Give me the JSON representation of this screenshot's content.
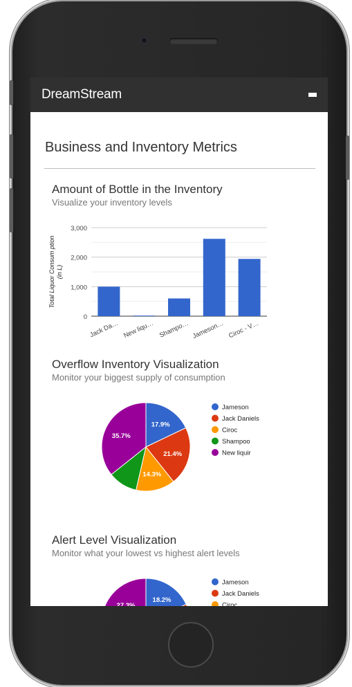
{
  "app": {
    "brand": "DreamStream"
  },
  "page": {
    "title": "Business and Inventory Metrics"
  },
  "sections": [
    {
      "title": "Amount of Bottle in the Inventory",
      "subtitle": "Visualize your inventory levels"
    },
    {
      "title": "Overflow Inventory Visualization",
      "subtitle": "Monitor your biggest supply of consumption"
    },
    {
      "title": "Alert Level Visualization",
      "subtitle": "Monitor what your lowest vs highest alert levels"
    }
  ],
  "colors": {
    "blue": "#3366cc",
    "red": "#dc3912",
    "orange": "#ff9900",
    "green": "#109618",
    "purple": "#990099",
    "navbar": "#303030"
  },
  "chart_data": [
    {
      "type": "bar",
      "categories": [
        "Jack Da…",
        "New liqu…",
        "Shampo…",
        "Jameson…",
        "Ciroc - V…"
      ],
      "values": [
        1000,
        20,
        600,
        2620,
        1940
      ],
      "ylabel": "Total Liquor Consum ption (in L)",
      "yticks": [
        "0",
        "1,000",
        "2,000",
        "3,000"
      ],
      "ylim": [
        0,
        3000
      ],
      "grid": true
    },
    {
      "type": "pie",
      "labels": [
        "Jameson",
        "Jack Daniels",
        "Ciroc",
        "Shampoo",
        "New liquir"
      ],
      "values": [
        17.9,
        21.4,
        14.3,
        10.7,
        35.7
      ],
      "slice_labels": [
        "17.9%",
        "21.4%",
        "14.3%",
        "",
        "35.7%"
      ],
      "legend": "right"
    },
    {
      "type": "pie",
      "labels": [
        "Jameson",
        "Jack Daniels",
        "Ciroc"
      ],
      "visible_slice_labels": [
        "18.2%",
        "27.3%"
      ],
      "legend": "right"
    }
  ]
}
